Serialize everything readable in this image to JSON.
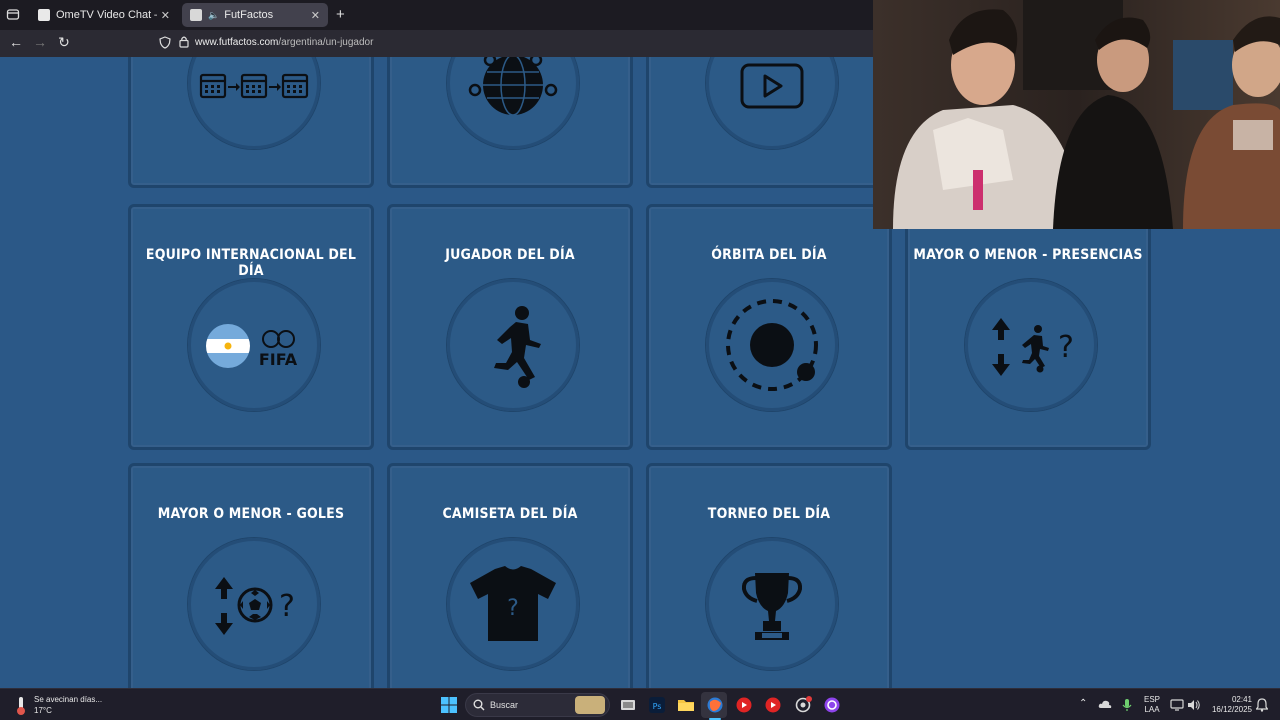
{
  "browser": {
    "tabs": [
      {
        "title": "OmeTV Video Chat — Omegle",
        "active": false
      },
      {
        "title": "FutFactos",
        "active": true
      }
    ],
    "url_host": "www.futfactos.com",
    "url_path": "/argentina/un-jugador"
  },
  "cards": [
    {
      "title": "",
      "icon": "calendar-sequence-icon"
    },
    {
      "title": "",
      "icon": "world-network-icon"
    },
    {
      "title": "",
      "icon": "video-play-icon"
    },
    {
      "title": "EQUIPO INTERNACIONAL DEL DÍA",
      "icon": "argentina-flag-fifa-icon"
    },
    {
      "title": "JUGADOR DEL DÍA",
      "icon": "player-silhouette-icon"
    },
    {
      "title": "ÓRBITA DEL DÍA",
      "icon": "orbit-icon"
    },
    {
      "title": "MAYOR O MENOR - PRESENCIAS",
      "icon": "player-arrows-question-icon"
    },
    {
      "title": "MAYOR O MENOR - GOLES",
      "icon": "ball-arrows-question-icon"
    },
    {
      "title": "CAMISETA DEL DÍA",
      "icon": "shirt-question-icon"
    },
    {
      "title": "TORNEO DEL DÍA",
      "icon": "trophy-icon"
    }
  ],
  "fifa_label": "FIFA",
  "taskbar": {
    "weather_line1": "Se avecinan días...",
    "weather_line2": "17°C",
    "search_label": "Buscar",
    "lang_line1": "ESP",
    "lang_line2": "LAA",
    "time": "02:41",
    "date": "16/12/2025"
  },
  "colors": {
    "page_bg": "#2b5887",
    "card_bg": "#2c5a87",
    "card_border": "#1f456c",
    "icon": "#0b0f14"
  }
}
